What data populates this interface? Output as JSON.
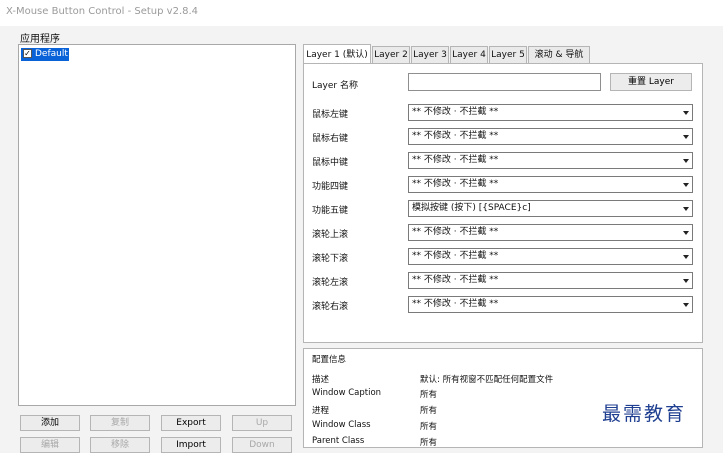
{
  "window": {
    "title": "X-Mouse Button Control - Setup v2.8.4"
  },
  "apps": {
    "label": "应用程序",
    "items": [
      {
        "label": "Default",
        "checked": true,
        "selected": true
      }
    ]
  },
  "buttons": {
    "add": "添加",
    "copy": "复制",
    "export": "Export",
    "up": "Up",
    "edit": "编辑",
    "remove": "移除",
    "import": "Import",
    "down": "Down"
  },
  "tabs": [
    {
      "label": "Layer 1 (默认)",
      "active": true
    },
    {
      "label": "Layer 2",
      "active": false
    },
    {
      "label": "Layer 3",
      "active": false
    },
    {
      "label": "Layer 4",
      "active": false
    },
    {
      "label": "Layer 5",
      "active": false
    },
    {
      "label": "滚动 & 导航",
      "active": false
    }
  ],
  "layer": {
    "name_label": "Layer 名称",
    "name_value": "",
    "reset_label": "重置 Layer",
    "mappings": [
      {
        "label": "鼠标左键",
        "value": "** 不修改 · 不拦截 **"
      },
      {
        "label": "鼠标右键",
        "value": "** 不修改 · 不拦截 **"
      },
      {
        "label": "鼠标中键",
        "value": "** 不修改 · 不拦截 **"
      },
      {
        "label": "功能四键",
        "value": "** 不修改 · 不拦截 **"
      },
      {
        "label": "功能五键",
        "value": "模拟按键 (按下) [{SPACE}c]"
      },
      {
        "label": "滚轮上滚",
        "value": "** 不修改 · 不拦截 **"
      },
      {
        "label": "滚轮下滚",
        "value": "** 不修改 · 不拦截 **"
      },
      {
        "label": "滚轮左滚",
        "value": "** 不修改 · 不拦截 **"
      },
      {
        "label": "滚轮右滚",
        "value": "** 不修改 · 不拦截 **"
      }
    ]
  },
  "profile_info": {
    "title": "配置信息",
    "rows": [
      {
        "key": "描述",
        "value": "默认: 所有视窗不匹配任何配置文件"
      },
      {
        "key": "Window Caption",
        "value": "所有"
      },
      {
        "key": "进程",
        "value": "所有"
      },
      {
        "key": "Window Class",
        "value": "所有"
      },
      {
        "key": "Parent Class",
        "value": "所有"
      }
    ]
  },
  "watermark": "最需教育",
  "colors": {
    "selection": "#0a62d8",
    "watermark": "#1f3f90",
    "background": "#f3f3f3"
  }
}
